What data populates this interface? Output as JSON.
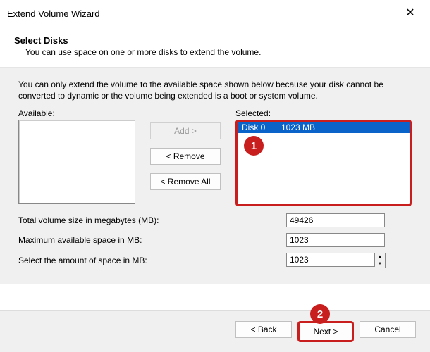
{
  "window": {
    "title": "Extend Volume Wizard",
    "close_glyph": "✕"
  },
  "header": {
    "title": "Select Disks",
    "subtitle": "You can use space on one or more disks to extend the volume."
  },
  "explain": "You can only extend the volume to the available space shown below because your disk cannot be converted to dynamic or the volume being extended is a boot or system volume.",
  "labels": {
    "available": "Available:",
    "selected": "Selected:"
  },
  "buttons": {
    "add": "Add >",
    "remove": "< Remove",
    "remove_all": "< Remove All",
    "back": "< Back",
    "next": "Next >",
    "cancel": "Cancel"
  },
  "selected_list": [
    {
      "disk": "Disk 0",
      "size": "1023 MB"
    }
  ],
  "fields": {
    "total_label": "Total volume size in megabytes (MB):",
    "total_value": "49426",
    "max_label": "Maximum available space in MB:",
    "max_value": "1023",
    "amount_label": "Select the amount of space in MB:",
    "amount_value": "1023"
  },
  "callouts": {
    "one": "1",
    "two": "2"
  }
}
